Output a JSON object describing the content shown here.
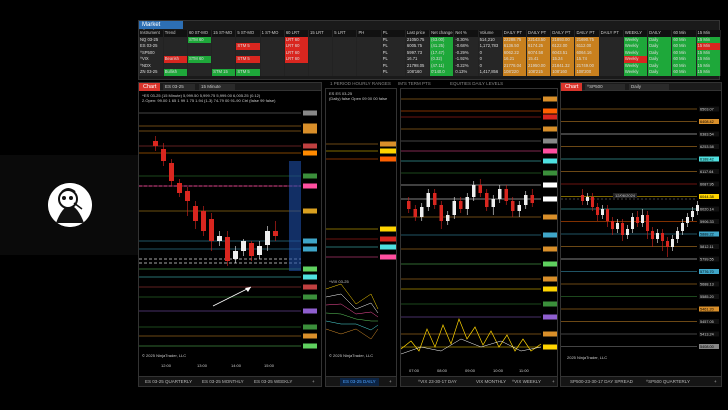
{
  "market_analyzer": {
    "title": "Market Analyzer",
    "columns": [
      "Instrument",
      "Trend",
      "60 ST-MO",
      "15 ST-MO",
      "5 ST-MO",
      "1 ST-MO",
      "60 LRT",
      "15 LRT",
      "5 LRT",
      "PH",
      "PL",
      "Last price",
      "Net change",
      "Net %",
      "Volume",
      "DAILY PT",
      "DAILY PT",
      "DAILY PT",
      "DAILY PT",
      "DAILY PT",
      "WEEKLY",
      "DAILY",
      "60 Min",
      "15 Min"
    ],
    "rows": [
      [
        "NQ 03-25",
        "",
        "STM 60",
        "",
        "",
        "",
        "LRT 60",
        "",
        "",
        "",
        "PL",
        "21050.75",
        "(63.00)",
        "-0.30%",
        "514,210",
        "22288.75",
        "22143.50",
        "21893.00",
        "21690.75",
        "",
        "Weekly",
        "Daily",
        "60 Min",
        "15 Min"
      ],
      [
        "ES 03-25",
        "",
        "",
        "",
        "STM 5",
        "",
        "LRT 60",
        "",
        "",
        "",
        "PL",
        "6005.75",
        "(41.25)",
        "-0.68%",
        "1,172,783",
        "6136.50",
        "6174.25",
        "6122.00",
        "6112.00",
        "",
        "Weekly",
        "Daily",
        "60 Min",
        "15 Min"
      ],
      [
        "^SP500",
        "",
        "",
        "",
        "",
        "",
        "LRT 60",
        "",
        "",
        "",
        "PL",
        "5997.73",
        "(17.47)",
        "-0.29%",
        "0",
        "6062.22",
        "6074.58",
        "6043.51",
        "6064.16",
        "",
        "Weekly",
        "Daily",
        "60 Min",
        "15 Min"
      ],
      [
        "^VIX",
        "Bearish",
        "STM 60",
        "",
        "STM 5",
        "",
        "LRT 60",
        "",
        "",
        "",
        "PL",
        "16.71",
        "(0.32)",
        "-1.92%",
        "0",
        "16.21",
        "15.41",
        "15.24",
        "15.74",
        "",
        "Weekly",
        "Daily",
        "60 Min",
        "15 Min"
      ],
      [
        "^NDX",
        "",
        "",
        "",
        "",
        "",
        "",
        "",
        "",
        "",
        "PL",
        "21798.05",
        "(47.11)",
        "-0.22%",
        "0",
        "21778.04",
        "21950.00",
        "21841.32",
        "21749.00",
        "",
        "Weekly",
        "Daily",
        "60 Min",
        "15 Min"
      ],
      [
        "ZN 03-25",
        "Bullish",
        "",
        "STM 15",
        "STM 5",
        "",
        "",
        "",
        "",
        "",
        "PL",
        "108'160",
        "0'140.0",
        "0.13%",
        "1,417,856",
        "108'220",
        "108'215",
        "108'160",
        "108'200",
        "",
        "Weekly",
        "Daily",
        "60 Min",
        "15 Min"
      ]
    ],
    "colors": {
      "green": "#1ea83a",
      "red": "#d9261f",
      "orange": "#c8801e",
      "row_bg": "#262626"
    }
  },
  "background_tabs": [
    "1 PERIOD HOURLY RANGES",
    "IM'S TERM PTS",
    "EQUITIES DAILY LEVELS"
  ],
  "panels": {
    "es": {
      "chart_label": "Chart",
      "instrument": "ES 03-25",
      "period": "15 Minute",
      "info": "^ES 03-25 (15 Minute) 5,999.50 5,999.75 5,999.00 6,005.25 (0.12)",
      "info2": "2.Open: 99.00 1 65 1 99 1 75 1.94 (1-3) 74-79 00 91-90 Ctrl (false 99 false)",
      "watermark": "© 2025 NinjaTrader, LLC",
      "time_labels": [
        "12:00",
        "13:00",
        "14:00",
        "15:00"
      ],
      "tabs": [
        "ES 03-25 QUARTERLY",
        "ES 03-25 MONTHLY",
        "ES 03-25 WEEKLY"
      ]
    },
    "es_daily": {
      "info": "ES ES 03-25",
      "info2": "(Daily) false Open 09 00 00 false",
      "info3": "^VIX 03-25",
      "watermark": "© 2025 NinjaTrader, LLC",
      "tab": "ES 03-25 DAILY"
    },
    "vix": {
      "chart_label": "Chart",
      "time_labels": [
        "07:00",
        "08:00",
        "09:00",
        "10:00",
        "11:00"
      ],
      "tabs": [
        "^VIX 23-30-17 DAY",
        "VIX MONTHLY",
        "^VIX WEEKLY"
      ]
    },
    "sp": {
      "chart_label": "Chart",
      "instrument": "^SP500",
      "period": "Daily",
      "date_label": "12/06/2024",
      "watermark": "2025 NinjaTrader, LLC",
      "tabs": [
        "SP500-23-30-17 DAY SPREAD",
        "^SP500 QUARTERLY"
      ],
      "price_labels": [
        "6503.07",
        "6408.42",
        "6383.54",
        "6253.58",
        "6188.42",
        "6117.64",
        "6087.95",
        "6044.38",
        "6020.14",
        "5906.33",
        "5888.22",
        "5812.11",
        "5799.55",
        "5776.70",
        "5688.13",
        "5585.20",
        "5461.20",
        "5457.05",
        "5413.24",
        "5408.00"
      ]
    }
  }
}
